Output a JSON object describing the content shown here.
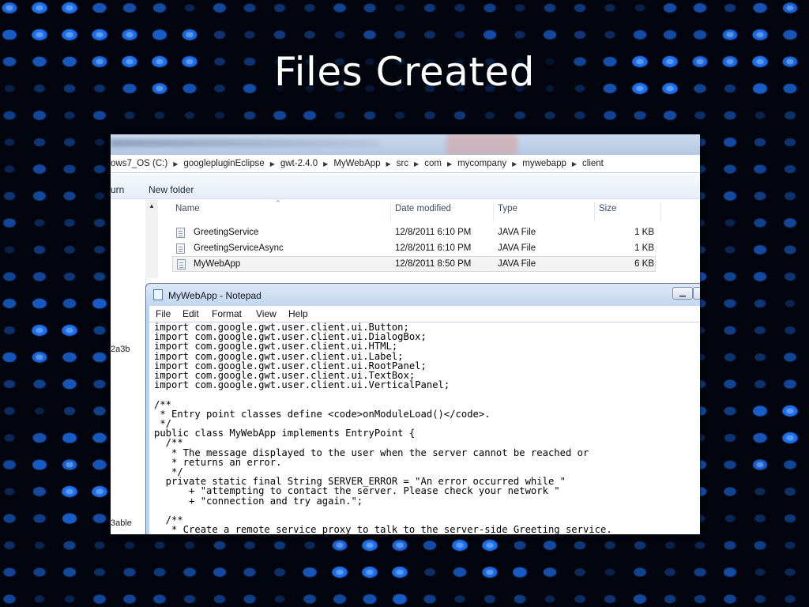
{
  "slide": {
    "title": "Files Created"
  },
  "explorer": {
    "breadcrumbs": [
      "ows7_OS (C:)",
      "googlepluginEclipse",
      "gwt-2.4.0",
      "MyWebApp",
      "src",
      "com",
      "mycompany",
      "mywebapp",
      "client"
    ],
    "toolbar": {
      "return_label": "urn",
      "new_folder_label": "New folder"
    },
    "nav_labels": [
      "2a3b",
      "3able"
    ],
    "columns": [
      "Name",
      "Date modified",
      "Type",
      "Size"
    ],
    "files": [
      {
        "name": "GreetingService",
        "date": "12/8/2011 6:10 PM",
        "type": "JAVA File",
        "size": "1 KB"
      },
      {
        "name": "GreetingServiceAsync",
        "date": "12/8/2011 6:10 PM",
        "type": "JAVA File",
        "size": "1 KB"
      },
      {
        "name": "MyWebApp",
        "date": "12/8/2011 8:50 PM",
        "type": "JAVA File",
        "size": "6 KB"
      }
    ]
  },
  "notepad": {
    "title": "MyWebApp - Notepad",
    "menu": [
      "File",
      "Edit",
      "Format",
      "View",
      "Help"
    ],
    "code": "import com.google.gwt.user.client.ui.Button;\nimport com.google.gwt.user.client.ui.DialogBox;\nimport com.google.gwt.user.client.ui.HTML;\nimport com.google.gwt.user.client.ui.Label;\nimport com.google.gwt.user.client.ui.RootPanel;\nimport com.google.gwt.user.client.ui.TextBox;\nimport com.google.gwt.user.client.ui.VerticalPanel;\n\n/**\n * Entry point classes define <code>onModuleLoad()</code>.\n */\npublic class MyWebApp implements EntryPoint {\n  /**\n   * The message displayed to the user when the server cannot be reached or\n   * returns an error.\n   */\n  private static final String SERVER_ERROR = \"An error occurred while \"\n      + \"attempting to contact the server. Please check your network \"\n      + \"connection and try again.\";\n\n  /**\n   * Create a remote service proxy to talk to the server-side Greeting service."
  },
  "icons": {
    "sort": "sort-up-icon",
    "file": "java-file-icon",
    "notepad": "notepad-icon",
    "minimize": "minimize-icon",
    "maximize": "maximize-icon",
    "breadcrumb_sep": "chevron-right-icon"
  },
  "colors": {
    "background": "#02050d",
    "dot_blue": "#1d6fe8",
    "selection": "#f3f3f3"
  }
}
